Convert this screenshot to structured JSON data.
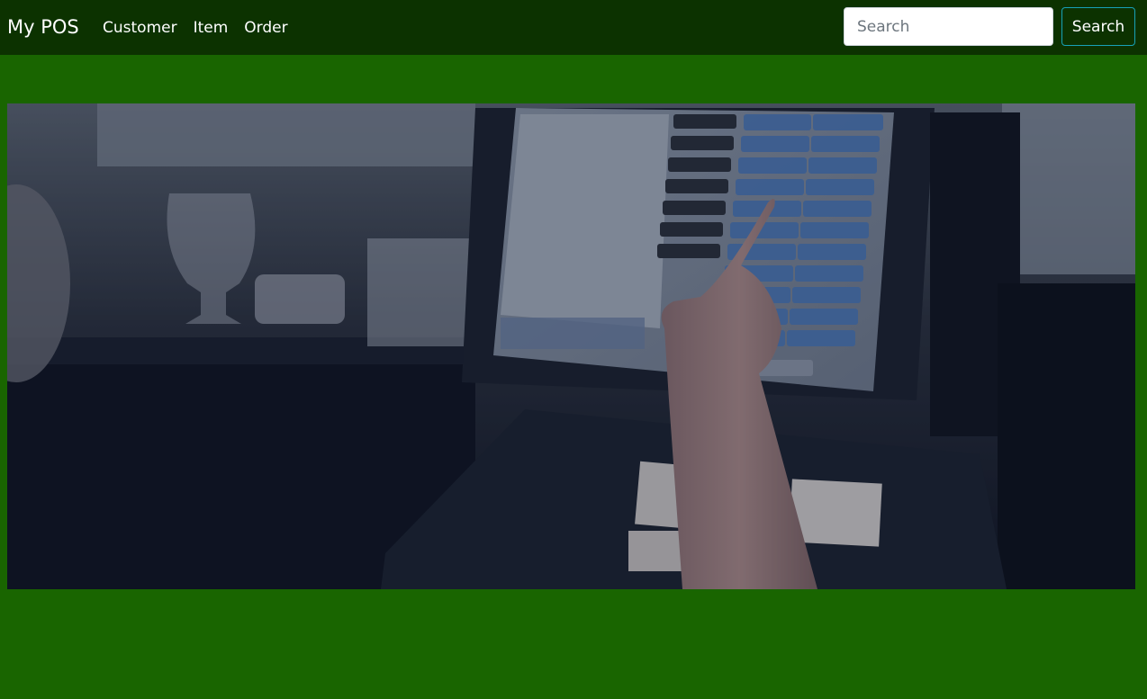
{
  "navbar": {
    "brand": "My POS",
    "links": [
      {
        "label": "Customer"
      },
      {
        "label": "Item"
      },
      {
        "label": "Order"
      }
    ],
    "search": {
      "placeholder": "Search",
      "value": "",
      "button_label": "Search"
    }
  },
  "hero": {
    "description_icon": "pos-terminal-photo"
  },
  "colors": {
    "page_background": "#196500",
    "navbar_background": "#0c3200",
    "search_button_border": "#17a2b8"
  }
}
